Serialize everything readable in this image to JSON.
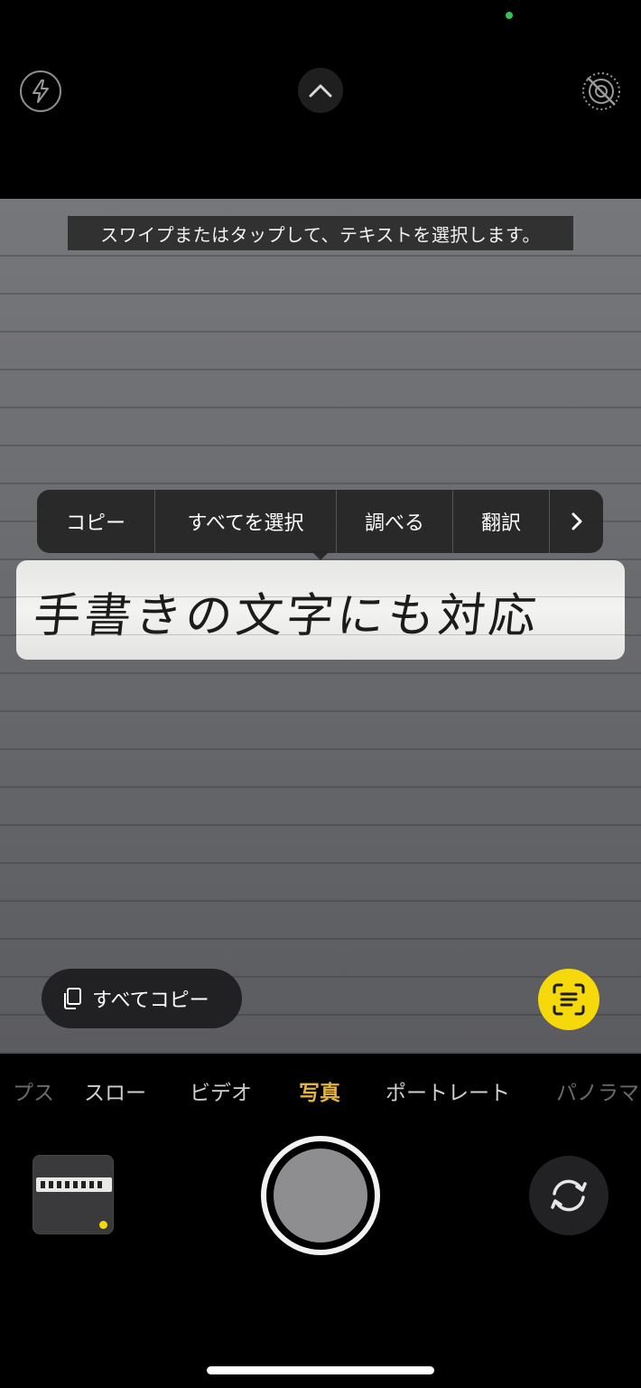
{
  "status": {
    "indicator_color": "#31c553"
  },
  "top_controls": {
    "flash_icon": "flash-bolt-icon",
    "expand_icon": "chevron-up-icon",
    "live_photo_icon": "live-photo-off-icon"
  },
  "viewfinder": {
    "hint": "スワイプまたはタップして、テキストを選択します。",
    "edit_menu": {
      "items": [
        "コピー",
        "すべてを選択",
        "調べる",
        "翻訳"
      ],
      "more_icon": "chevron-right-icon"
    },
    "selected_text": "手書きの文字にも対応",
    "copy_all_label": "すべてコピー",
    "live_text_icon": "live-text-scan-icon",
    "accent_color": "#f5d90a"
  },
  "modes": {
    "items": [
      "タイムラプス",
      "スロー",
      "ビデオ",
      "写真",
      "ポートレート",
      "パノラマ"
    ],
    "visible_items": [
      "プス",
      "スロー",
      "ビデオ",
      "写真",
      "ポートレート",
      "パノラマ"
    ],
    "active": "写真",
    "active_color": "#e2b43f"
  },
  "bottom_controls": {
    "thumbnail_icon": "last-photo-thumbnail",
    "shutter_icon": "shutter-button",
    "flip_icon": "camera-flip-icon"
  }
}
